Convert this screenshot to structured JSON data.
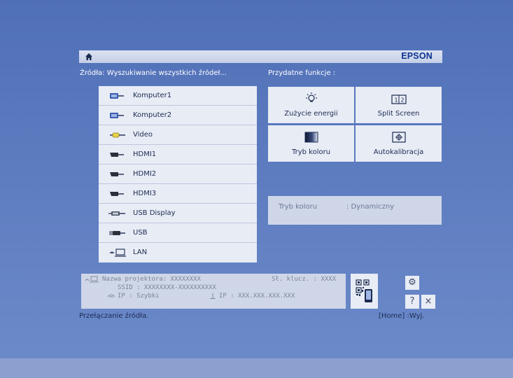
{
  "header": {
    "brand": "EPSON",
    "home_icon": "home-icon"
  },
  "sources_panel": {
    "label": "Źródła: Wyszukiwanie wszystkich źródeł...",
    "items": [
      {
        "label": "Komputer1",
        "icon": "computer-connector-icon"
      },
      {
        "label": "Komputer2",
        "icon": "computer-connector-icon"
      },
      {
        "label": "Video",
        "icon": "video-connector-icon"
      },
      {
        "label": "HDMI1",
        "icon": "hdmi-connector-icon"
      },
      {
        "label": "HDMI2",
        "icon": "hdmi-connector-icon"
      },
      {
        "label": "HDMI3",
        "icon": "hdmi-connector-icon"
      },
      {
        "label": "USB Display",
        "icon": "usb-display-icon"
      },
      {
        "label": "USB",
        "icon": "usb-icon"
      },
      {
        "label": "LAN",
        "icon": "lan-icon"
      }
    ]
  },
  "functions_panel": {
    "label": "Przydatne funkcje :",
    "items": [
      {
        "label": "Zużycie energii",
        "icon": "bulb-icon"
      },
      {
        "label": "Split Screen",
        "icon": "split-screen-icon"
      },
      {
        "label": "Tryb koloru",
        "icon": "color-mode-icon"
      },
      {
        "label": "Autokalibracja",
        "icon": "autocalibration-icon"
      }
    ]
  },
  "info": {
    "label": "Tryb koloru",
    "value": ": Dynamiczny"
  },
  "network": {
    "projector_name": "Nazwa projektora:  XXXXXXXX",
    "key": "Sł. klucz. :  XXXX",
    "ssid": "SSID :  XXXXXXXX-XXXXXXXXXX",
    "ip_mode": "IP :  Szybki",
    "ip_address": "IP :  XXX.XXX.XXX.XXX"
  },
  "buttons": {
    "qr": "qr-code-icon",
    "settings": "⚙",
    "help": "?",
    "close": "×"
  },
  "status": {
    "left": "Przełączanie źródła.",
    "right": "[Home] :Wyj."
  },
  "colors": {
    "background": "#5a79bd",
    "panel": "#e8ecf5",
    "brand": "#0c3391",
    "text": "#1b2b50"
  }
}
